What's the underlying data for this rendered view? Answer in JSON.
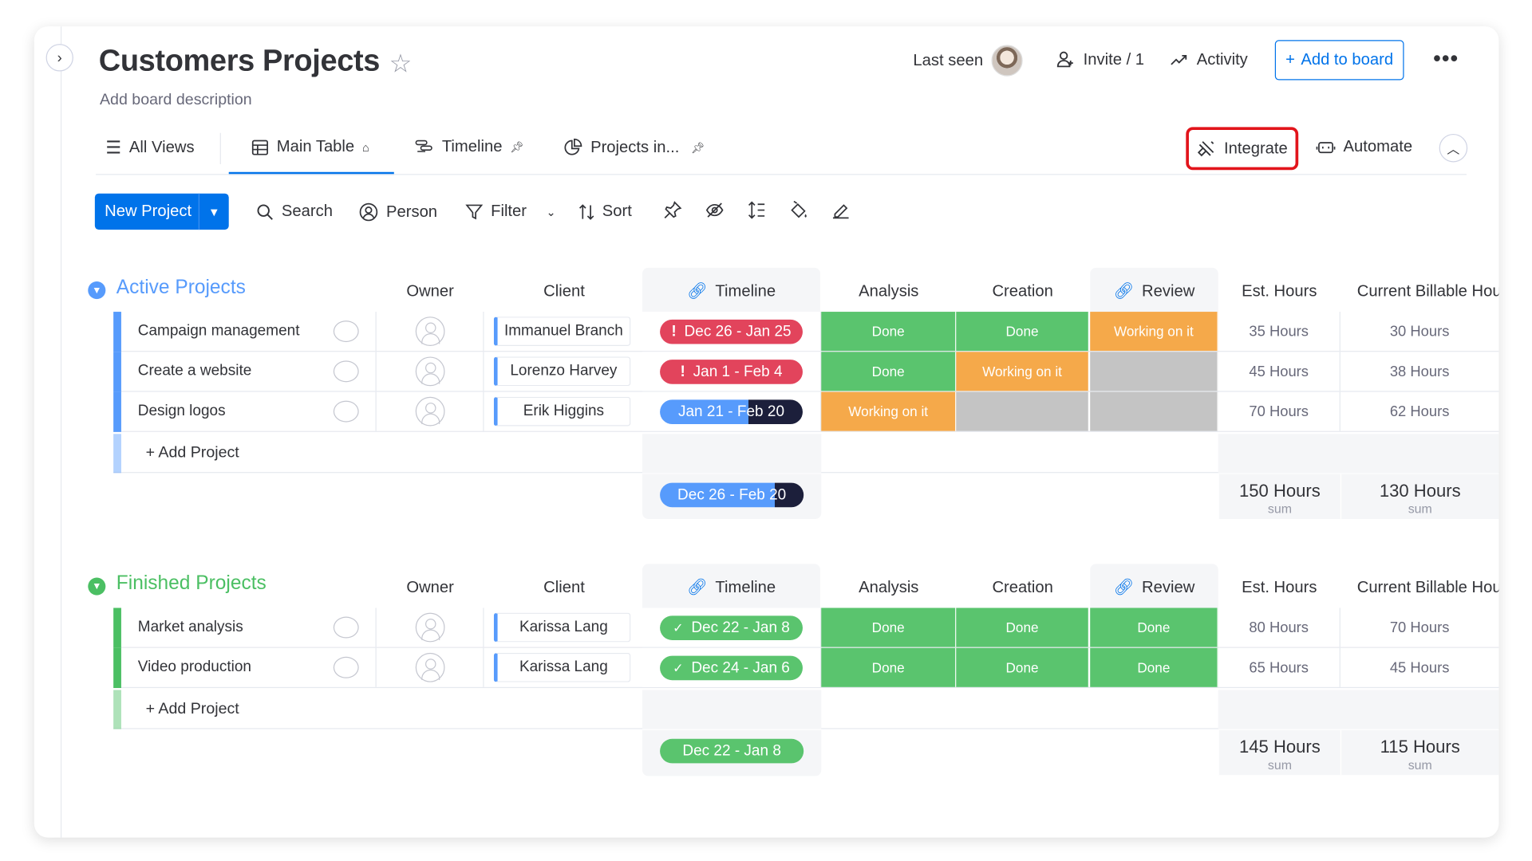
{
  "board": {
    "title": "Customers Projects",
    "description": "Add board description",
    "last_seen": "Last seen",
    "invite": "Invite / 1",
    "activity": "Activity",
    "add_to_board": "Add to board"
  },
  "tabs": {
    "all_views": "All Views",
    "main_table": "Main Table",
    "timeline": "Timeline",
    "projects": "Projects in...",
    "integrate": "Integrate",
    "automate": "Automate"
  },
  "toolbar": {
    "new_project": "New Project",
    "search": "Search",
    "person": "Person",
    "filter": "Filter",
    "sort": "Sort"
  },
  "columns": {
    "owner": "Owner",
    "client": "Client",
    "timeline": "Timeline",
    "analysis": "Analysis",
    "creation": "Creation",
    "review": "Review",
    "est_hours": "Est. Hours",
    "billable": "Current Billable Hours"
  },
  "colors": {
    "accent": "#0073ea",
    "done": "#5ac46e",
    "working": "#f5a94a",
    "empty": "#c4c4c4",
    "stuck": "#e2445c",
    "active_group": "#579bfc",
    "finished_group": "#4bbf63"
  },
  "groups": [
    {
      "title": "Active Projects",
      "add_label": "+ Add Project",
      "rows": [
        {
          "name": "Campaign management",
          "client": "Immanuel Branch",
          "timeline": "Dec 26 - Jan 25",
          "analysis": "Done",
          "creation": "Done",
          "review": "Working on it",
          "est": "35 Hours",
          "billable": "30 Hours"
        },
        {
          "name": "Create a website",
          "client": "Lorenzo Harvey",
          "timeline": "Jan 1 - Feb 4",
          "analysis": "Done",
          "creation": "Working on it",
          "review": "",
          "est": "45 Hours",
          "billable": "38 Hours"
        },
        {
          "name": "Design logos",
          "client": "Erik Higgins",
          "timeline": "Jan 21 - Feb 20",
          "analysis": "Working on it",
          "creation": "",
          "review": "",
          "est": "70 Hours",
          "billable": "62 Hours"
        }
      ],
      "summary": {
        "timeline": "Dec 26 - Feb 20",
        "est": "150 Hours",
        "billable": "130 Hours",
        "label": "sum"
      }
    },
    {
      "title": "Finished Projects",
      "add_label": "+ Add Project",
      "rows": [
        {
          "name": "Market analysis",
          "client": "Karissa Lang",
          "timeline": "Dec 22 - Jan 8",
          "analysis": "Done",
          "creation": "Done",
          "review": "Done",
          "est": "80 Hours",
          "billable": "70 Hours"
        },
        {
          "name": "Video production",
          "client": "Karissa Lang",
          "timeline": "Dec 24 - Jan 6",
          "analysis": "Done",
          "creation": "Done",
          "review": "Done",
          "est": "65 Hours",
          "billable": "45 Hours"
        }
      ],
      "summary": {
        "timeline": "Dec 22 - Jan 8",
        "est": "145 Hours",
        "billable": "115 Hours",
        "label": "sum"
      }
    }
  ]
}
